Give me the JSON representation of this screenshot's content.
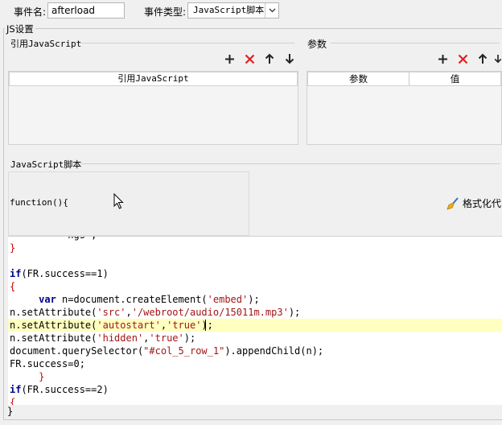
{
  "event": {
    "name_label": "事件名:",
    "name_value": "afterload",
    "type_label": "事件类型:",
    "type_value": "JavaScript脚本"
  },
  "js_settings": {
    "title": "JS设置",
    "ref_js": {
      "title": "引用JavaScript",
      "column_header": "引用JavaScript"
    },
    "params": {
      "title": "参数",
      "col_param": "参数",
      "col_value": "值"
    },
    "script": {
      "title": "JavaScript脚本",
      "func_header": "function(){",
      "format_label": "格式化代",
      "closing_brace": "}"
    }
  },
  "code": {
    "lines": [
      "          ngs ,",
      "}",
      "",
      "if(FR.success==1)",
      "{",
      "     var n=document.createElement('embed');",
      "n.setAttribute('src','/webroot/audio/15011m.mp3');",
      "n.setAttribute('autostart','true');",
      "n.setAttribute('hidden','true');",
      "document.querySelector(\"#col_5_row_1\").appendChild(n);",
      "FR.success=0;",
      "     }",
      "if(FR.success==2)",
      "{"
    ]
  },
  "colors": {
    "highlight_line": "#ffffc0",
    "delete_red": "#e02020",
    "keyword": "#00008b",
    "string": "#a31515"
  },
  "icons": [
    "plus-icon",
    "delete-icon",
    "arrow-up-icon",
    "arrow-down-icon",
    "broom-icon",
    "mouse-cursor-icon"
  ]
}
